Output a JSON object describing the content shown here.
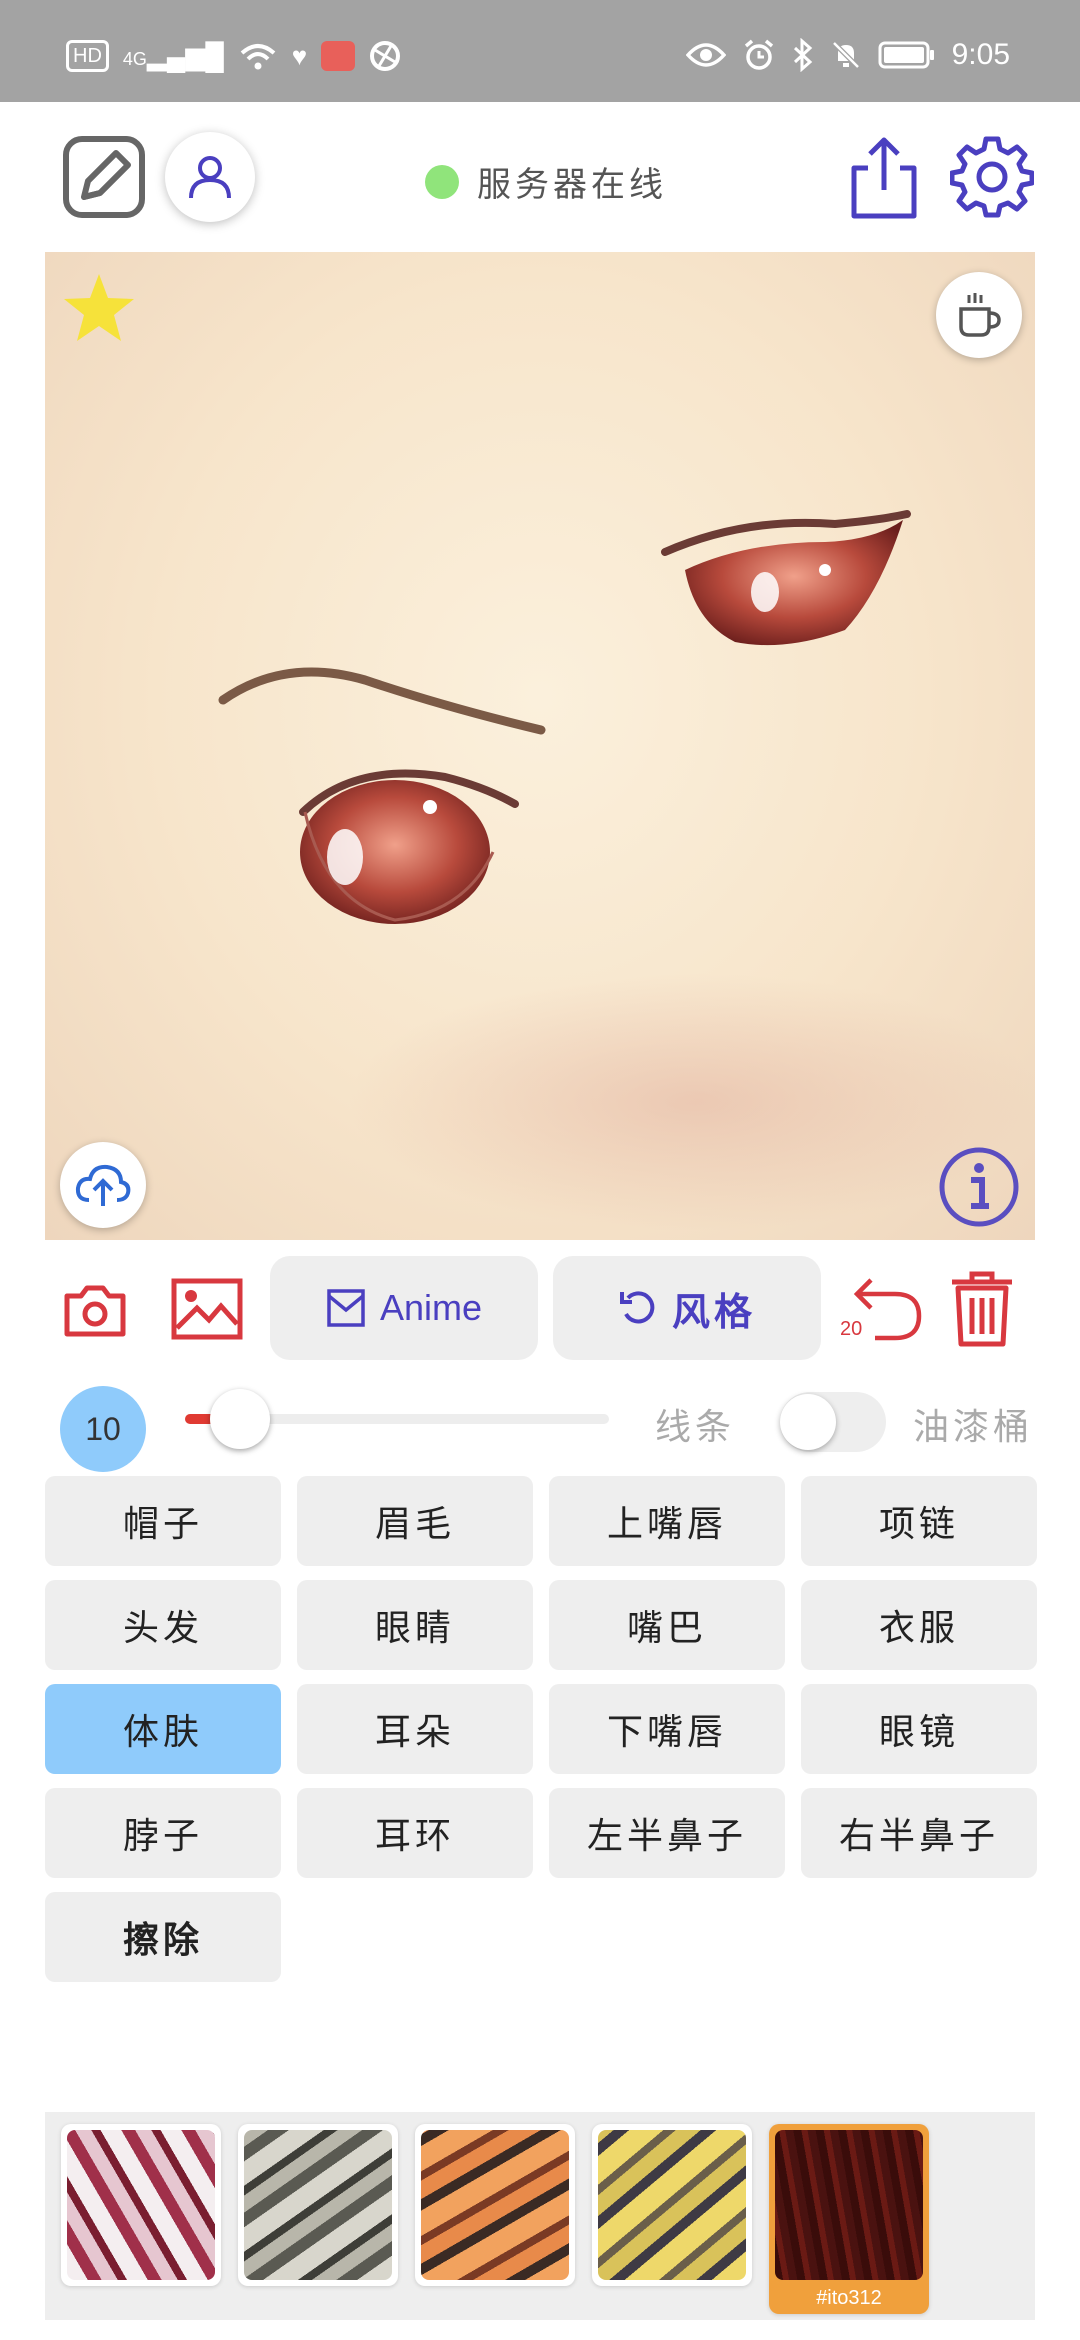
{
  "status_bar": {
    "left_indicators": [
      "HD",
      "4G"
    ],
    "time": "9:05"
  },
  "header": {
    "server_status_text": "服务器在线",
    "server_status_color": "#90e47b"
  },
  "toolbar": {
    "model_button_label": "Anime",
    "style_button_label": "风格",
    "undo_count": "20"
  },
  "brush": {
    "size": "10",
    "size_fraction": 0.13,
    "line_label": "线条",
    "bucket_label": "油漆桶",
    "bucket_enabled": false
  },
  "parts": [
    {
      "label": "帽子"
    },
    {
      "label": "眉毛"
    },
    {
      "label": "上嘴唇"
    },
    {
      "label": "项链"
    },
    {
      "label": "头发"
    },
    {
      "label": "眼睛"
    },
    {
      "label": "嘴巴"
    },
    {
      "label": "衣服"
    },
    {
      "label": "体肤",
      "selected": true
    },
    {
      "label": "耳朵"
    },
    {
      "label": "下嘴唇"
    },
    {
      "label": "眼镜"
    },
    {
      "label": "脖子"
    },
    {
      "label": "耳环"
    },
    {
      "label": "左半鼻子"
    },
    {
      "label": "右半鼻子"
    },
    {
      "label": "擦除",
      "bold": true
    }
  ],
  "palette": {
    "active_label": "#ito312"
  },
  "colors": {
    "accent": "#4a3fc0",
    "danger": "#d8383f",
    "selected": "#8fcbfb",
    "active_swatch": "#f0a03c"
  }
}
